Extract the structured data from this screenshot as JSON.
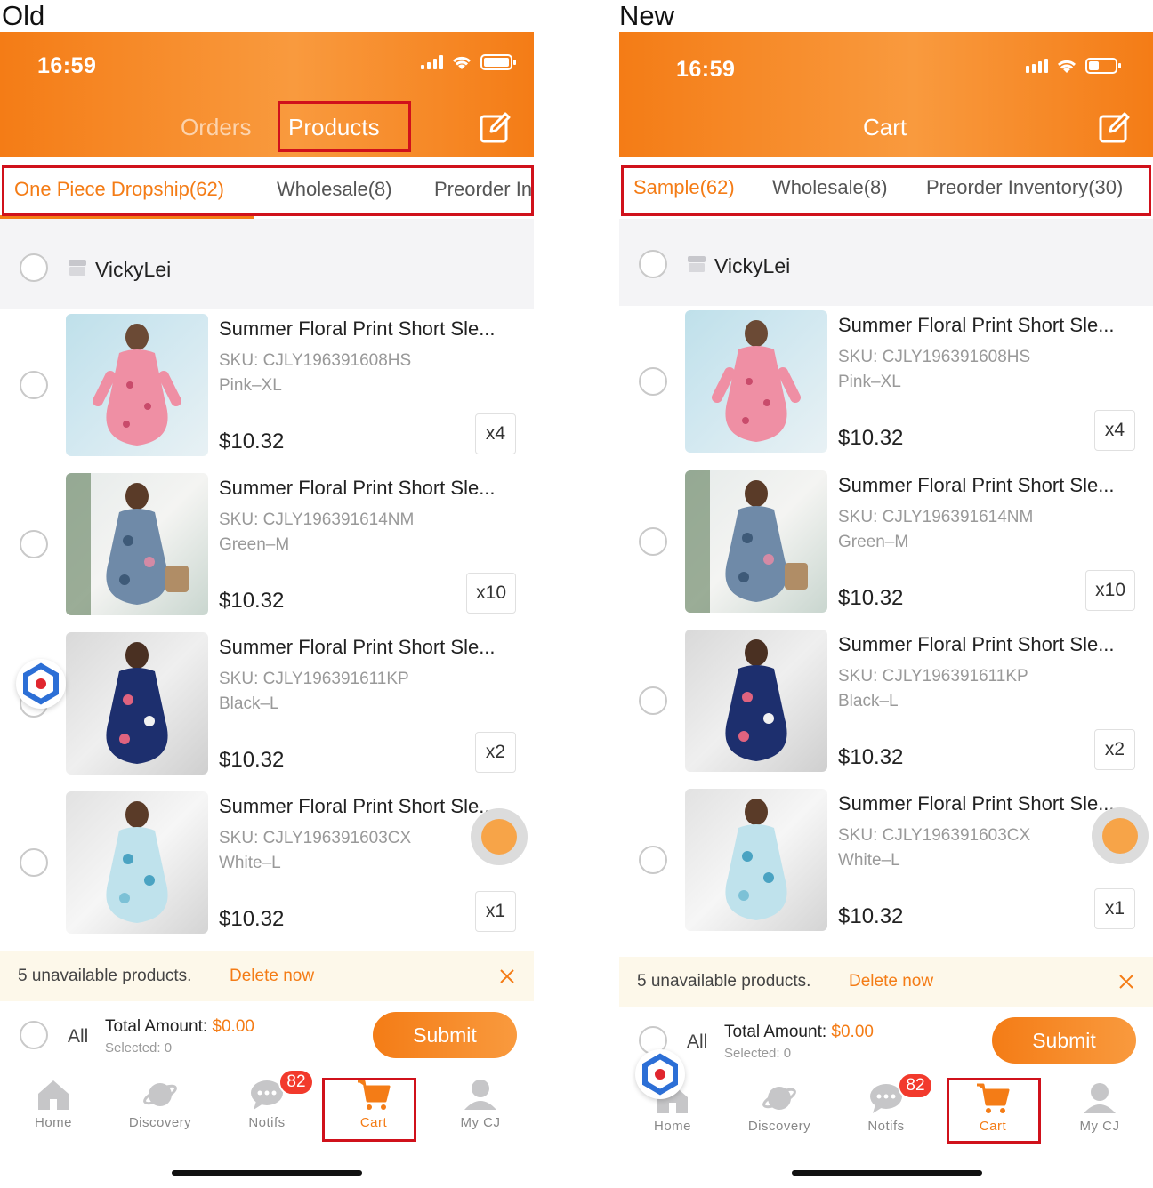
{
  "labels": {
    "old": "Old",
    "new": "New"
  },
  "colors": {
    "accent": "#f47c16",
    "highlight": "#d0111b",
    "badge": "#f23a2c"
  },
  "old": {
    "time": "16:59",
    "tab_orders": "Orders",
    "tab_products": "Products",
    "subtabs": [
      "One Piece Dropship(62)",
      "Wholesale(8)",
      "Preorder In"
    ],
    "store": "VickyLei",
    "products": [
      {
        "title": "Summer Floral Print Short Sle...",
        "sku": "SKU: CJLY196391608HS",
        "variant": "Pink–XL",
        "price": "$10.32",
        "qty": "x4"
      },
      {
        "title": "Summer Floral Print Short Sle...",
        "sku": "SKU: CJLY196391614NM",
        "variant": "Green–M",
        "price": "$10.32",
        "qty": "x10"
      },
      {
        "title": "Summer Floral Print Short Sle...",
        "sku": "SKU: CJLY196391611KP",
        "variant": "Black–L",
        "price": "$10.32",
        "qty": "x2"
      },
      {
        "title": "Summer Floral Print Short Sle...",
        "sku": "SKU: CJLY196391603CX",
        "variant": "White–L",
        "price": "$10.32",
        "qty": "x1"
      }
    ],
    "warning": "5 unavailable products.",
    "delete_now": "Delete now",
    "all": "All",
    "total_label": "Total Amount: ",
    "total_value": "$0.00",
    "selected": "Selected: 0",
    "submit": "Submit",
    "nav": [
      "Home",
      "Discovery",
      "Notifs",
      "Cart",
      "My CJ"
    ],
    "notifs_badge": "82"
  },
  "new": {
    "time": "16:59",
    "title": "Cart",
    "subtabs": [
      "Sample(62)",
      "Wholesale(8)",
      "Preorder Inventory(30)"
    ],
    "store": "VickyLei",
    "products": [
      {
        "title": "Summer Floral Print Short Sle...",
        "sku": "SKU: CJLY196391608HS",
        "variant": "Pink–XL",
        "price": "$10.32",
        "qty": "x4"
      },
      {
        "title": "Summer Floral Print Short Sle...",
        "sku": "SKU: CJLY196391614NM",
        "variant": "Green–M",
        "price": "$10.32",
        "qty": "x10"
      },
      {
        "title": "Summer Floral Print Short Sle...",
        "sku": "SKU: CJLY196391611KP",
        "variant": "Black–L",
        "price": "$10.32",
        "qty": "x2"
      },
      {
        "title": "Summer Floral Print Short Sle...",
        "sku": "SKU: CJLY196391603CX",
        "variant": "White–L",
        "price": "$10.32",
        "qty": "x1"
      }
    ],
    "warning": "5 unavailable products.",
    "delete_now": "Delete now",
    "all": "All",
    "total_label": "Total Amount: ",
    "total_value": "$0.00",
    "selected": "Selected: 0",
    "submit": "Submit",
    "nav": [
      "Home",
      "Discovery",
      "Notifs",
      "Cart",
      "My CJ"
    ],
    "notifs_badge": "82"
  }
}
